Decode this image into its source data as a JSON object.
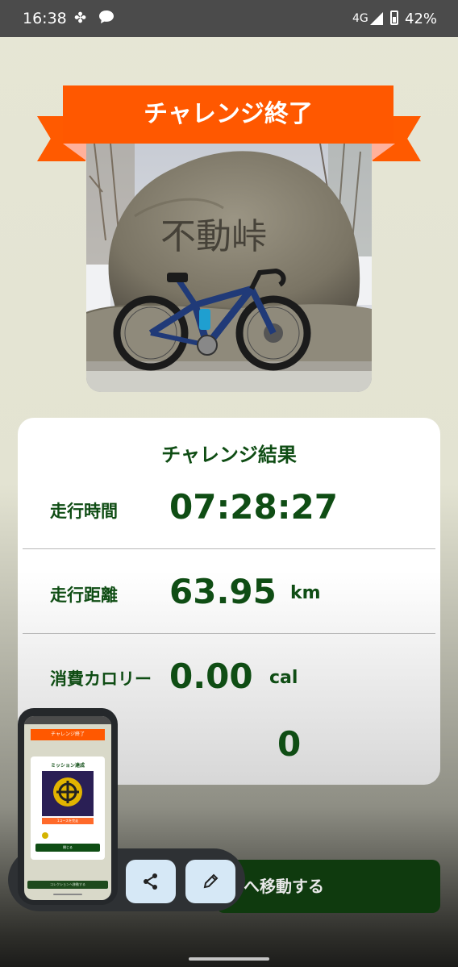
{
  "status_bar": {
    "time": "16:38",
    "network": "4G",
    "battery": "42%",
    "battery_level": 42
  },
  "banner": {
    "title": "チャレンジ終了"
  },
  "photo": {
    "stone_text": "不動峠"
  },
  "results": {
    "title": "チャレンジ結果",
    "rows": [
      {
        "label": "走行時間",
        "value": "07:28:27",
        "unit": ""
      },
      {
        "label": "走行距離",
        "value": "63.95",
        "unit": "km"
      },
      {
        "label": "消費カロリー",
        "value": "0.00",
        "unit": "cal"
      },
      {
        "label": "",
        "value": "0",
        "unit": ""
      }
    ]
  },
  "bottom_button": {
    "label": "へ移動する"
  },
  "overlay": {
    "share_icon": "share-icon",
    "edit_icon": "pencil-icon",
    "thumbnail": {
      "ribbon": "チャレンジ終了",
      "dialog_title": "ミッション達成",
      "orange_button": "1コースを完走",
      "green_button": "閉じる",
      "bottom_button": "コレクションへ移動する"
    }
  },
  "colors": {
    "ribbon": "#ff5800",
    "primary_green": "#0f4d14",
    "button_dark_green": "#0f3a0e",
    "overlay_button": "#d6e8f6"
  }
}
